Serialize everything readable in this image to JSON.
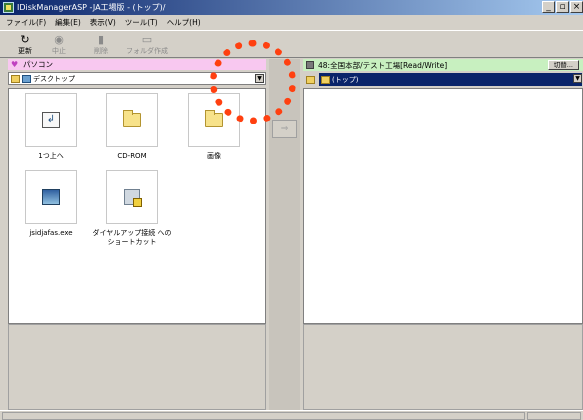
{
  "window": {
    "title": "IDiskManagerASP -JA工場版 - (トップ)/",
    "buttons": [
      "_",
      "▫",
      "×"
    ]
  },
  "menu": [
    {
      "label": "ファイル(F)"
    },
    {
      "label": "編集(E)"
    },
    {
      "label": "表示(V)"
    },
    {
      "label": "ツール(T)"
    },
    {
      "label": "ヘルプ(H)"
    }
  ],
  "toolbar": {
    "refresh": "更新",
    "stop": "中止",
    "delete": "削除",
    "new_folder": "フォルダ作成"
  },
  "left": {
    "header": "パソコン",
    "location": "デスクトップ",
    "items": [
      {
        "label": "1つ上へ",
        "icon": "up-folder-icon"
      },
      {
        "label": "CD-ROM",
        "icon": "folder-icon"
      },
      {
        "label": "画像",
        "icon": "folder-icon"
      },
      {
        "label": "jsidjafas.exe",
        "icon": "exe-icon"
      },
      {
        "label": "ダイヤルアップ接続 への ショートカット",
        "icon": "shortcut-icon"
      }
    ]
  },
  "transfer": {
    "arrow": "⇒"
  },
  "right": {
    "header": "48:全国本部/テスト工場[Read/Write]",
    "switch_label": "切替...",
    "location": "(トップ)"
  },
  "colors": {
    "left_header": "#f8c8f0",
    "right_header": "#c8f0c0",
    "annotation": "#ff4010",
    "selection": "#0a246a"
  }
}
